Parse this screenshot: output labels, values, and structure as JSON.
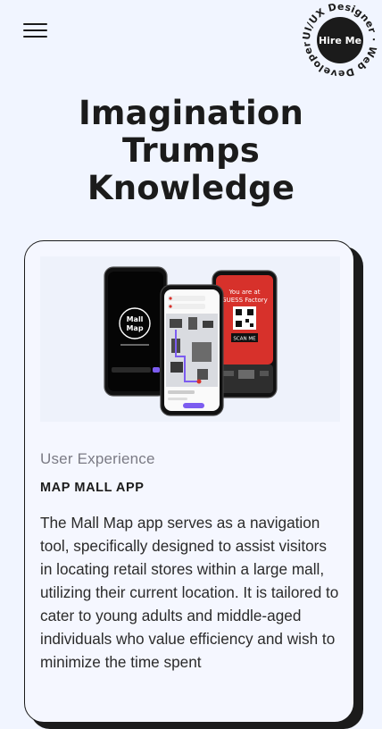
{
  "header": {
    "menu_icon": "hamburger-menu-icon",
    "badge": {
      "label": "Hire Me",
      "ring_text": "UI/UX Designer · Web Developer ·"
    }
  },
  "hero": {
    "title_line1": "Imagination",
    "title_line2": "Trumps",
    "title_line3": "Knowledge"
  },
  "project_card": {
    "image": {
      "phone_left_logo_line1": "Mall",
      "phone_left_logo_line2": "Map",
      "phone_right_heading_line1": "You are at",
      "phone_right_heading_line2": "GUESS Factory",
      "phone_right_button": "SCAN ME"
    },
    "category": "User Experience",
    "title": "MAP MALL APP",
    "description": "The Mall Map app serves as a navigation tool, specifically designed to assist visitors in locating retail stores within a large mall, utilizing their current location. It is tailored to cater to young adults and middle-aged individuals who value efficiency and wish to minimize the time spent"
  },
  "colors": {
    "background": "#f1f5ff",
    "ink": "#1b1b1b",
    "muted": "#7b7b85",
    "accent_red": "#d7312b",
    "accent_purple": "#7c5cf0"
  }
}
